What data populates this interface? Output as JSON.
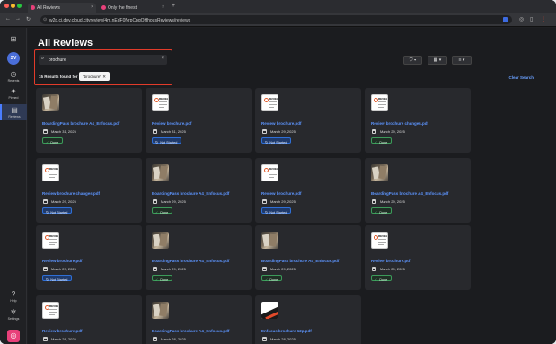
{
  "browser": {
    "tabs": [
      {
        "label": "All Reviews",
        "fav_color": "#e8407a"
      },
      {
        "label": "Only the finest!",
        "fav_color": "#e8407a"
      }
    ],
    "url": "w2p.ci.dev.cloud.cityreview/4m.nEdF0NrpCpqOHhousReviews/reviews"
  },
  "sidebar": {
    "avatar_initials": "SV",
    "items": [
      {
        "label": "Recents",
        "icon": "clock-icon"
      },
      {
        "label": "Pinned",
        "icon": "pin-icon"
      },
      {
        "label": "Reviews",
        "icon": "reviews-icon"
      }
    ],
    "help_label": "Help",
    "settings_label": "Settings"
  },
  "main": {
    "title": "All Reviews",
    "search": {
      "value": "brochure",
      "placeholder": "Search"
    },
    "results_text": "15 Results found for",
    "chip_label": "\"brochure\"",
    "clear_search": "Clear Search"
  },
  "cards": [
    {
      "name": "BoardingPass brochure A4_Enfocus.pdf",
      "date": "March 31, 2025",
      "status": "Done",
      "thumb": "brochure"
    },
    {
      "name": "Review brochure.pdf",
      "date": "March 31, 2025",
      "status": "Not Started",
      "thumb": "review"
    },
    {
      "name": "Review brochure.pdf",
      "date": "March 29, 2025",
      "status": "Not Started",
      "thumb": "review"
    },
    {
      "name": "Review brochure changes.pdf",
      "date": "March 29, 2025",
      "status": "Done",
      "thumb": "review"
    },
    {
      "name": "Review brochure changes.pdf",
      "date": "March 29, 2025",
      "status": "Not Started",
      "thumb": "review"
    },
    {
      "name": "BoardingPass brochure A4_Enfocus.pdf",
      "date": "March 29, 2025",
      "status": "Done",
      "thumb": "brochure"
    },
    {
      "name": "Review brochure.pdf",
      "date": "March 29, 2025",
      "status": "Not Started",
      "thumb": "review"
    },
    {
      "name": "BoardingPass brochure A4_Enfocus.pdf",
      "date": "March 29, 2025",
      "status": "Done",
      "thumb": "brochure"
    },
    {
      "name": "Review brochure.pdf",
      "date": "March 29, 2025",
      "status": "Not Started",
      "thumb": "review"
    },
    {
      "name": "BoardingPass brochure A4_Enfocus.pdf",
      "date": "March 29, 2025",
      "status": "Done",
      "thumb": "brochure"
    },
    {
      "name": "BoardingPass brochure A4_Enfocus.pdf",
      "date": "March 29, 2025",
      "status": "Done",
      "thumb": "brochure"
    },
    {
      "name": "Review brochure.pdf",
      "date": "March 29, 2025",
      "status": "Done",
      "thumb": "review"
    },
    {
      "name": "Review brochure.pdf",
      "date": "March 28, 2025",
      "status": "",
      "thumb": "review"
    },
    {
      "name": "BoardingPass brochure A4_Enfocus.pdf",
      "date": "March 28, 2025",
      "status": "",
      "thumb": "brochure"
    },
    {
      "name": "Enfocus brochure 12p.pdf",
      "date": "March 28, 2025",
      "status": "",
      "thumb": "erfocus"
    }
  ],
  "colors": {
    "accent": "#5d95ff",
    "done": "#3c9a5a",
    "not_started": "#2f6fd6",
    "highlight": "#e23b2a"
  }
}
